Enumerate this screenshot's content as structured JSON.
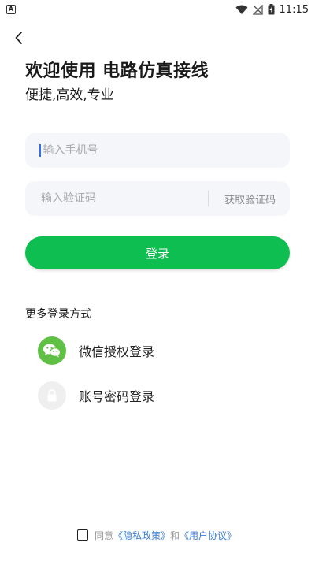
{
  "status_bar": {
    "notification_icon": "a-notification-icon",
    "time": "11:15"
  },
  "header": {
    "back_icon": "chevron-left-icon",
    "title": "欢迎使用 电路仿真接线",
    "subtitle": "便捷,高效,专业"
  },
  "form": {
    "phone_placeholder": "输入手机号",
    "phone_value": "",
    "code_placeholder": "输入验证码",
    "code_value": "",
    "get_code_label": "获取验证码",
    "login_label": "登录"
  },
  "more_login": {
    "title": "更多登录方式",
    "methods": [
      {
        "label": "微信授权登录",
        "icon": "wechat-icon",
        "icon_bg": "#60c045"
      },
      {
        "label": "账号密码登录",
        "icon": "lock-icon",
        "icon_bg": "#efefef"
      }
    ]
  },
  "agreement": {
    "agree_text": "同意",
    "privacy_link": "《隐私政策》",
    "and_text": "和",
    "user_link": "《用户协议》"
  },
  "colors": {
    "primary": "#0fbe50",
    "link": "#3a7bd5",
    "field_bg": "#f4f6fa"
  }
}
